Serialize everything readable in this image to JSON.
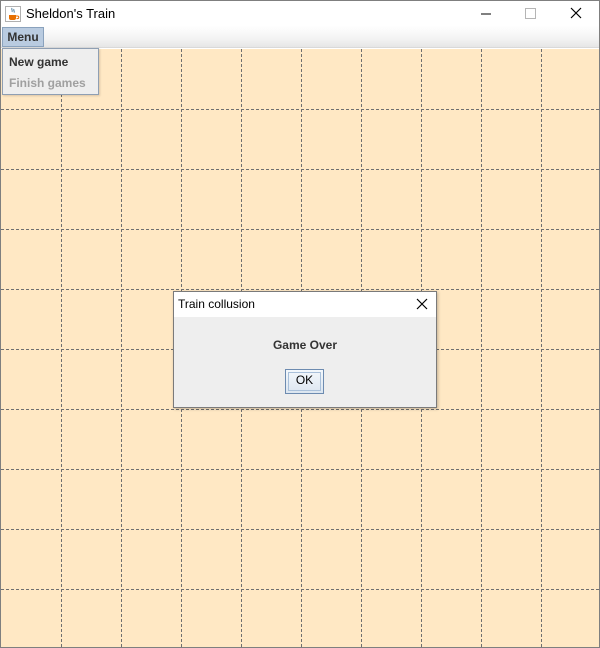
{
  "window": {
    "title": "Sheldon's Train",
    "app_icon": "java-cup-icon",
    "controls": [
      "minimize-icon",
      "maximize-icon",
      "close-icon"
    ]
  },
  "menubar": {
    "menu_label": "Menu"
  },
  "popup_menu": {
    "items": [
      {
        "label": "New game",
        "enabled": true
      },
      {
        "label": "Finish games",
        "enabled": false
      }
    ]
  },
  "board": {
    "columns": 10,
    "rows": 10,
    "background_color": "#ffe8c4",
    "grid_color": "#6f6f6f",
    "grid_style": "dashed"
  },
  "dialog": {
    "title": "Train collusion",
    "message": "Game Over",
    "ok_label": "OK",
    "close_icon": "close-icon"
  }
}
